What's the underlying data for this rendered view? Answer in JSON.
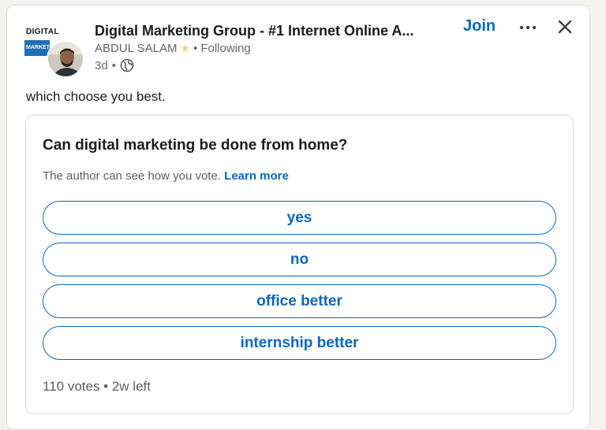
{
  "group": {
    "name": "Digital Marketing Group - #1 Internet Online A...",
    "logo_text_top": "DIGITAL",
    "logo_text_banner": "MARKETING"
  },
  "author": {
    "name": "ABDUL SALAM",
    "badge_icon": "star-icon",
    "separator": "•",
    "follow_status": "Following"
  },
  "post_meta": {
    "age": "3d",
    "separator": "•",
    "visibility_icon": "globe-icon"
  },
  "actions": {
    "join_label": "Join",
    "more_icon": "ellipsis-icon",
    "close_icon": "close-icon"
  },
  "post_text": "which choose you best.",
  "poll": {
    "question": "Can digital marketing be done from home?",
    "notice": "The author can see how you vote.",
    "learn_more": "Learn more",
    "options": [
      {
        "label": "yes"
      },
      {
        "label": "no"
      },
      {
        "label": "office better"
      },
      {
        "label": "internship better"
      }
    ],
    "footer": "110 votes • 2w left"
  },
  "colors": {
    "accent": "#0a66c2",
    "text": "#1b1b1b",
    "muted": "#666666",
    "border": "#dcdad6",
    "page_bg": "#f4f2ee"
  }
}
